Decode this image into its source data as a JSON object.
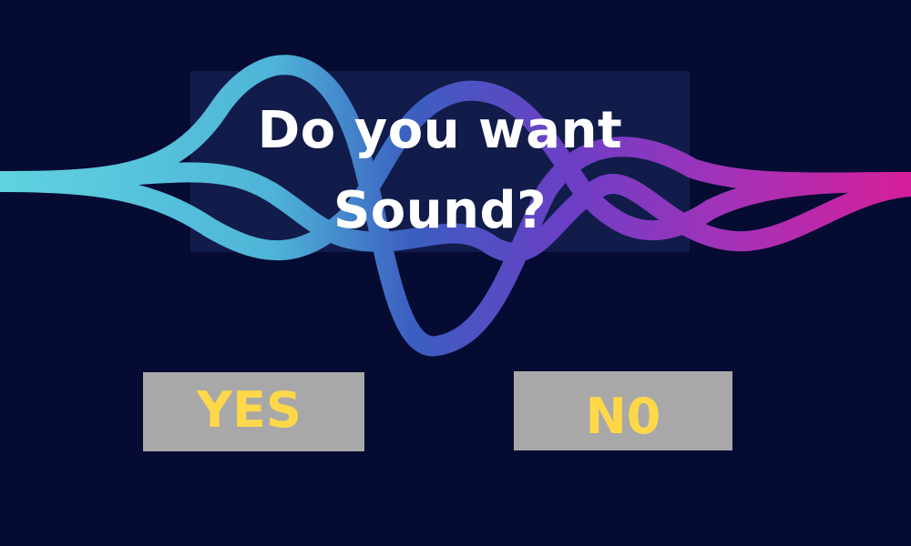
{
  "prompt": {
    "line1": "Do you want",
    "line2": "Sound?"
  },
  "choices": {
    "yes_label": "YES",
    "no_label": "N0"
  },
  "colors": {
    "background": "#050b32",
    "button_fill": "#a8a8a8",
    "button_text": "#ffd84a",
    "question_text": "#ffffff",
    "wave_cyan": "#5fd3e0",
    "wave_blue": "#3b5fc0",
    "wave_purple": "#7a3ec8",
    "wave_magenta": "#d61f9a"
  }
}
